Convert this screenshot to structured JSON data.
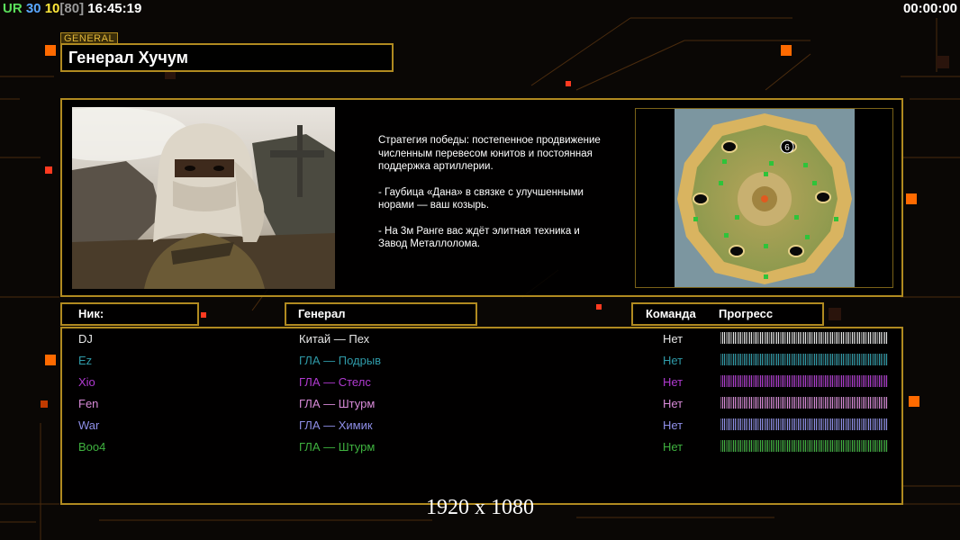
{
  "hud": {
    "faction": "UR",
    "value_a": "30",
    "value_b": "10",
    "value_c": "[80]",
    "clock": "16:45:19",
    "timer": "00:00:00"
  },
  "general": {
    "tag": "GENERAL",
    "name": "Генерал Хучум",
    "strategy": [
      "Стратегия победы: постепенное продвижение численным перевесом юнитов и постоянная поддержка артиллерии.",
      "- Гаубица «Дана» в связке с улучшенными норами — ваш козырь.",
      "- На 3м Ранге вас ждёт элитная техника и Завод Металлолома."
    ]
  },
  "minimap": {
    "label": "6"
  },
  "table": {
    "headers": {
      "nick": "Ник:",
      "general": "Генерал",
      "team": "Команда",
      "progress": "Прогресс"
    },
    "rows": [
      {
        "nick": "DJ",
        "general": "Китай — Пех",
        "team": "Нет",
        "color": "#e6e6e6",
        "progress": 1.0
      },
      {
        "nick": "Ez",
        "general": "ГЛА — Подрыв",
        "team": "Нет",
        "color": "#2f9aa8",
        "progress": 1.0
      },
      {
        "nick": "Xio",
        "general": "ГЛА — Стелс",
        "team": "Нет",
        "color": "#b03ad0",
        "progress": 1.0
      },
      {
        "nick": "Fen",
        "general": "ГЛА — Штурм",
        "team": "Нет",
        "color": "#d88ad8",
        "progress": 1.0
      },
      {
        "nick": "War",
        "general": "ГЛА — Химик",
        "team": "Нет",
        "color": "#8f8fe8",
        "progress": 1.0
      },
      {
        "nick": "Boo4",
        "general": "ГЛА — Штурм",
        "team": "Нет",
        "color": "#3fb23f",
        "progress": 1.0
      }
    ]
  },
  "footer": {
    "resolution": "1920 x 1080"
  },
  "colors": {
    "accent": "#b08a20",
    "glow": "#ff6a00"
  }
}
